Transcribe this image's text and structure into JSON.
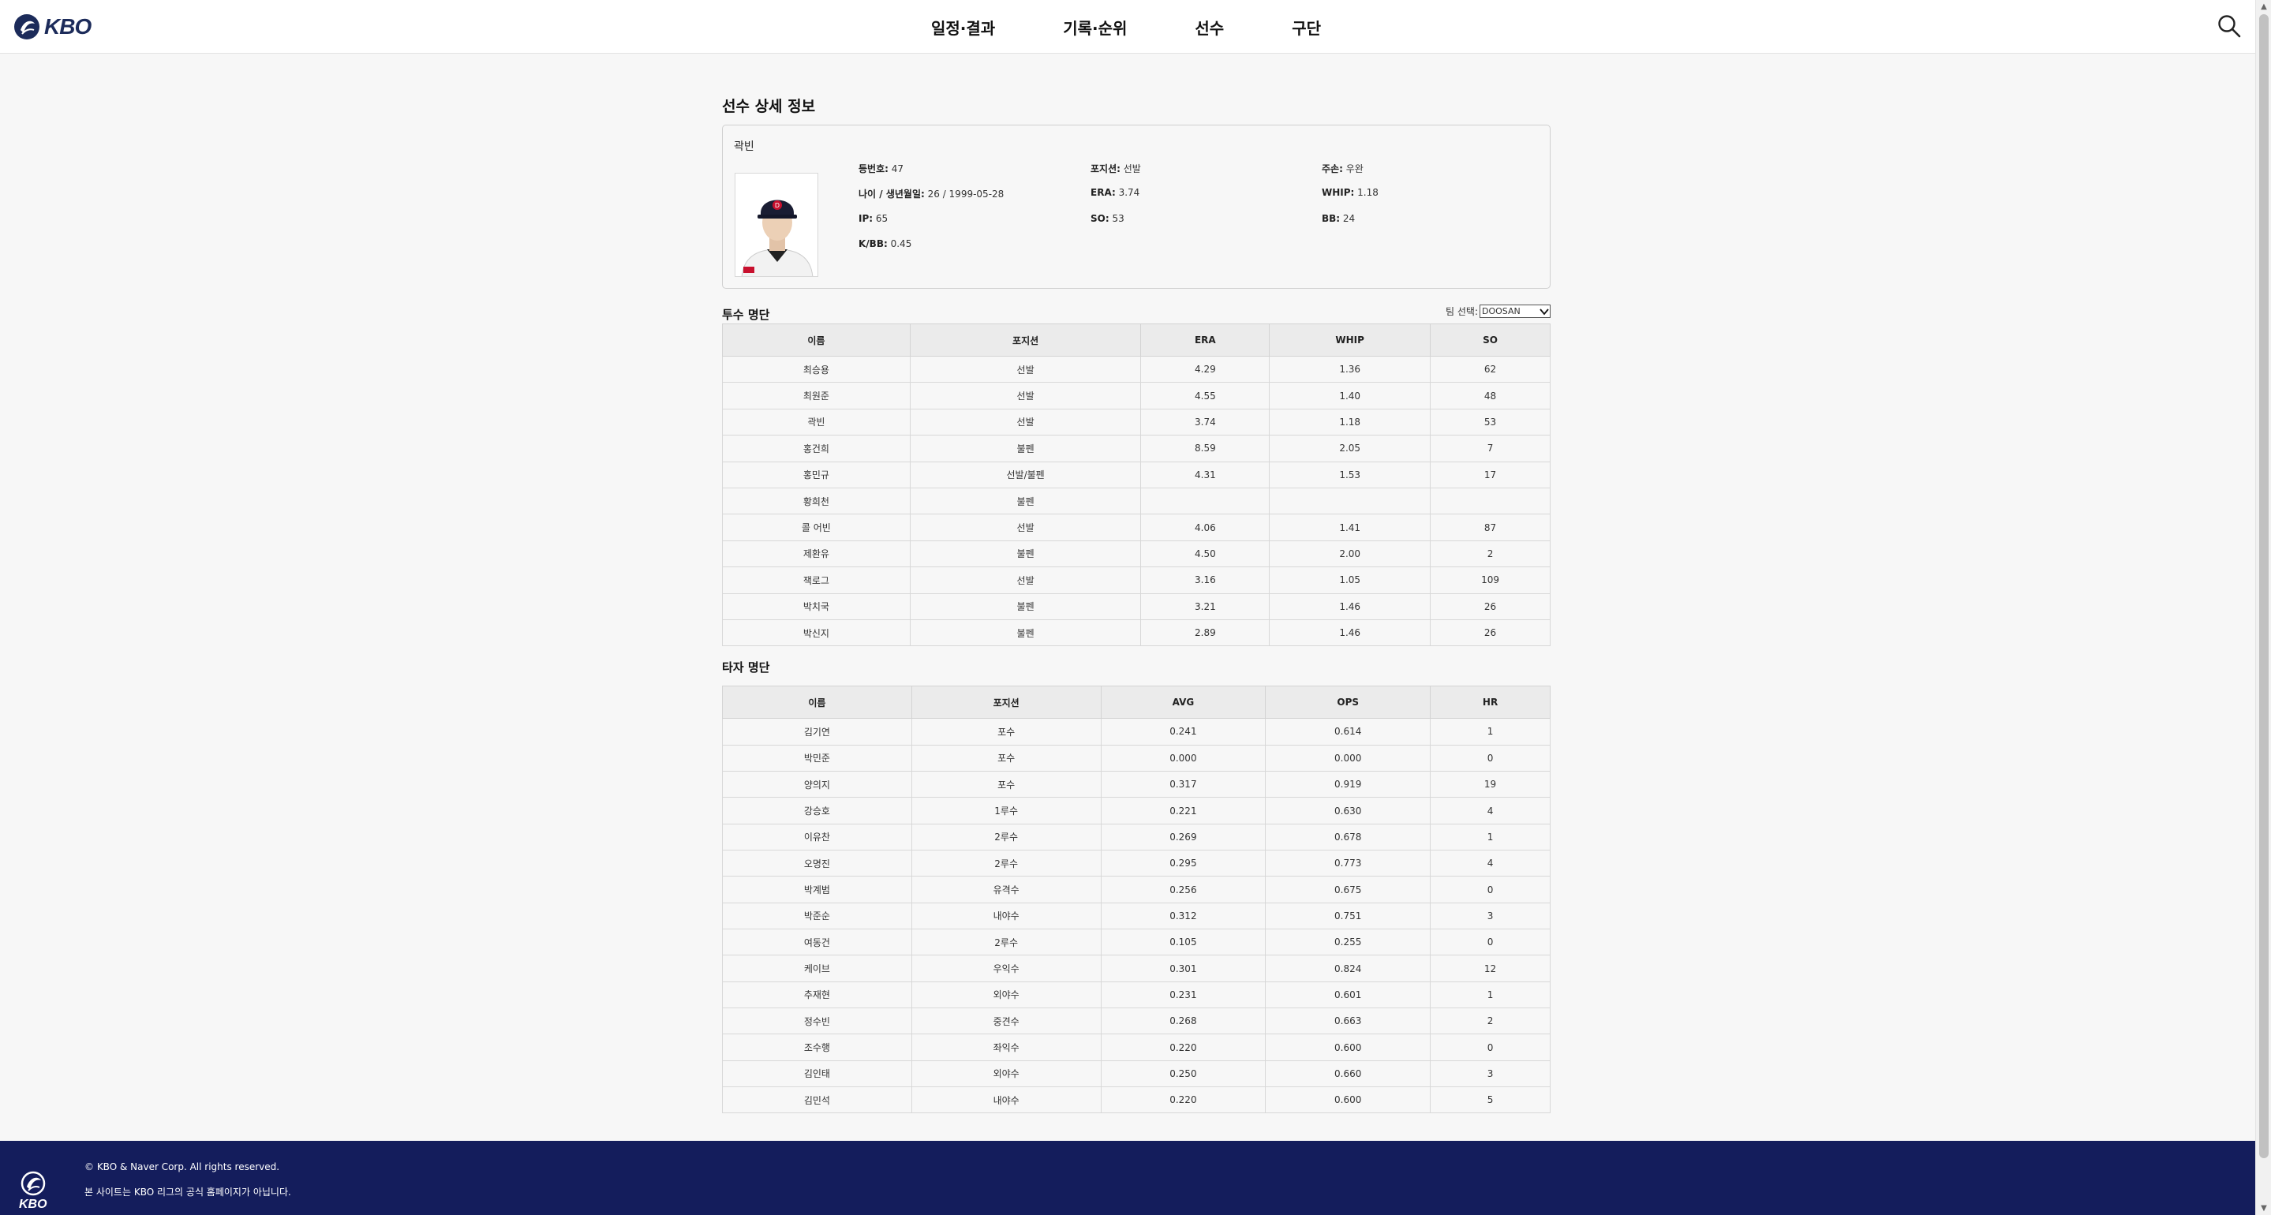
{
  "header": {
    "logo_text": "KBO",
    "nav": [
      "일정·결과",
      "기록·순위",
      "선수",
      "구단"
    ]
  },
  "page_title": "선수 상세 정보",
  "player": {
    "name": "곽빈",
    "stats": [
      {
        "label": "등번호:",
        "value": "47"
      },
      {
        "label": "포지션:",
        "value": "선발"
      },
      {
        "label": "주손:",
        "value": "우완"
      },
      {
        "label": "나이 / 생년월일:",
        "value": "26 / 1999-05-28"
      },
      {
        "label": "ERA:",
        "value": "3.74"
      },
      {
        "label": "WHIP:",
        "value": "1.18"
      },
      {
        "label": "IP:",
        "value": "65"
      },
      {
        "label": "SO:",
        "value": "53"
      },
      {
        "label": "BB:",
        "value": "24"
      },
      {
        "label": "K/BB:",
        "value": "0.45"
      }
    ]
  },
  "pitchers": {
    "title": "투수 명단",
    "team_select_label": "팀 선택:",
    "team_selected": "DOOSAN",
    "columns": [
      "이름",
      "포지션",
      "ERA",
      "WHIP",
      "SO"
    ],
    "rows": [
      [
        "최승용",
        "선발",
        "4.29",
        "1.36",
        "62"
      ],
      [
        "최원준",
        "선발",
        "4.55",
        "1.40",
        "48"
      ],
      [
        "곽빈",
        "선발",
        "3.74",
        "1.18",
        "53"
      ],
      [
        "홍건희",
        "불펜",
        "8.59",
        "2.05",
        "7"
      ],
      [
        "홍민규",
        "선발/불펜",
        "4.31",
        "1.53",
        "17"
      ],
      [
        "황희천",
        "불펜",
        "",
        "",
        ""
      ],
      [
        "콜 어빈",
        "선발",
        "4.06",
        "1.41",
        "87"
      ],
      [
        "제환유",
        "불펜",
        "4.50",
        "2.00",
        "2"
      ],
      [
        "잭로그",
        "선발",
        "3.16",
        "1.05",
        "109"
      ],
      [
        "박치국",
        "불펜",
        "3.21",
        "1.46",
        "26"
      ],
      [
        "박신지",
        "불펜",
        "2.89",
        "1.46",
        "26"
      ]
    ]
  },
  "hitters": {
    "title": "타자 명단",
    "columns": [
      "이름",
      "포지션",
      "AVG",
      "OPS",
      "HR"
    ],
    "rows": [
      [
        "김기연",
        "포수",
        "0.241",
        "0.614",
        "1"
      ],
      [
        "박민준",
        "포수",
        "0.000",
        "0.000",
        "0"
      ],
      [
        "양의지",
        "포수",
        "0.317",
        "0.919",
        "19"
      ],
      [
        "강승호",
        "1루수",
        "0.221",
        "0.630",
        "4"
      ],
      [
        "이유찬",
        "2루수",
        "0.269",
        "0.678",
        "1"
      ],
      [
        "오명진",
        "2루수",
        "0.295",
        "0.773",
        "4"
      ],
      [
        "박계범",
        "유격수",
        "0.256",
        "0.675",
        "0"
      ],
      [
        "박준순",
        "내야수",
        "0.312",
        "0.751",
        "3"
      ],
      [
        "여동건",
        "2루수",
        "0.105",
        "0.255",
        "0"
      ],
      [
        "케이브",
        "우익수",
        "0.301",
        "0.824",
        "12"
      ],
      [
        "추재현",
        "외야수",
        "0.231",
        "0.601",
        "1"
      ],
      [
        "정수빈",
        "중견수",
        "0.268",
        "0.663",
        "2"
      ],
      [
        "조수행",
        "좌익수",
        "0.220",
        "0.600",
        "0"
      ],
      [
        "김인태",
        "외야수",
        "0.250",
        "0.660",
        "3"
      ],
      [
        "김민석",
        "내야수",
        "0.220",
        "0.600",
        "5"
      ]
    ]
  },
  "footer": {
    "logo_text": "KBO",
    "lines": [
      "© KBO & Naver Corp. All rights reserved.",
      "본 사이트는 KBO 리그의 공식 홈페이지가 아닙니다."
    ]
  },
  "colors": {
    "footer_bg": "#141d5c",
    "brand_navy": "#1c2b5a",
    "page_bg": "#f7f7f7"
  },
  "icons": [
    "kbo-logo-icon",
    "search-icon",
    "chevron-down-icon"
  ]
}
